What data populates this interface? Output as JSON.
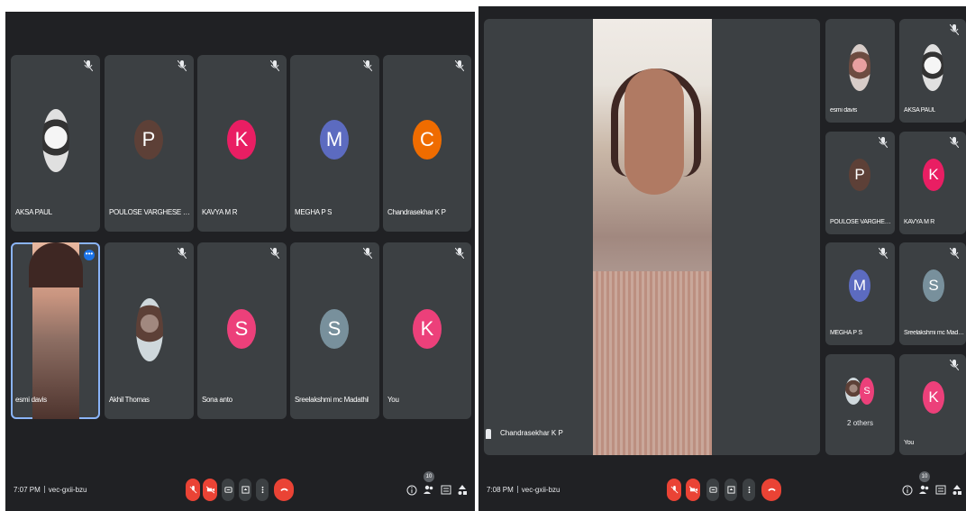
{
  "left": {
    "tiles": [
      {
        "name": "AKSA PAUL",
        "avatar": "photo"
      },
      {
        "name": "POULOSE VARGHESE KODAMKA...",
        "avatar": "P",
        "color": "#5d4037"
      },
      {
        "name": "KAVYA M R",
        "avatar": "K",
        "color": "#e91e63"
      },
      {
        "name": "MEGHA P S",
        "avatar": "M",
        "color": "#5c6bc0"
      },
      {
        "name": "Chandrasekhar K P",
        "avatar": "C",
        "color": "#ef6c00"
      },
      {
        "name": "esmi davis",
        "avatar": "video"
      },
      {
        "name": "Akhil Thomas",
        "avatar": "photo"
      },
      {
        "name": "Sona anto",
        "avatar": "S",
        "color": "#ec407a"
      },
      {
        "name": "Sreelakshmi mc Madathil",
        "avatar": "S",
        "color": "#78909c"
      },
      {
        "name": "You",
        "avatar": "K",
        "color": "#ec407a"
      }
    ],
    "time": "7:07 PM",
    "meeting_code": "vec-gxii-bzu",
    "participants_count": "10"
  },
  "right": {
    "speaker_name": "Chandrasekhar K P",
    "tiles": [
      {
        "name": "esmi davis",
        "avatar": "photo"
      },
      {
        "name": "AKSA PAUL",
        "avatar": "photo"
      },
      {
        "name": "POULOSE VARGHESE K...",
        "avatar": "P",
        "color": "#5d4037"
      },
      {
        "name": "KAVYA M R",
        "avatar": "K",
        "color": "#e91e63"
      },
      {
        "name": "MEGHA P S",
        "avatar": "M",
        "color": "#5c6bc0"
      },
      {
        "name": "Sreelakshmi mc Madat...",
        "avatar": "S",
        "color": "#78909c"
      },
      {
        "name": "2 others",
        "avatar": "S",
        "color": "#ec407a"
      },
      {
        "name": "You",
        "avatar": "K",
        "color": "#ec407a"
      }
    ],
    "time": "7:08 PM",
    "meeting_code": "vec-gxii-bzu",
    "participants_count": "10"
  },
  "icons": {
    "mic_off": "mic-off-icon",
    "cam_off": "videocam-off-icon",
    "captions": "closed-caption-icon",
    "present": "present-screen-icon",
    "more": "more-vert-icon",
    "end": "call-end-icon",
    "info": "info-icon",
    "people": "people-icon",
    "chat": "chat-icon",
    "activities": "activities-icon"
  }
}
